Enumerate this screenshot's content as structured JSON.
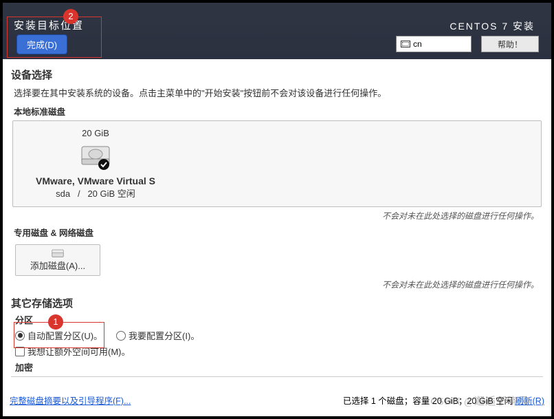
{
  "header": {
    "title": "安装目标位置",
    "done_label": "完成(D)",
    "product": "CENTOS 7 安装",
    "lang": "cn",
    "help_label": "帮助！"
  },
  "annotations": {
    "badge1": "1",
    "badge2": "2"
  },
  "device_select": {
    "title": "设备选择",
    "subtitle": "选择要在其中安装系统的设备。点击主菜单中的\"开始安装\"按钮前不会对该设备进行任何操作。",
    "local_title": "本地标准磁盘",
    "disk": {
      "size": "20 GiB",
      "name": "VMware, VMware Virtual S",
      "dev": "sda",
      "sep": "/",
      "free": "20 GiB 空闲"
    },
    "note": "不会对未在此处选择的磁盘进行任何操作。",
    "special_title": "专用磁盘 & 网络磁盘",
    "add_disk_label": "添加磁盘(A)..."
  },
  "storage_opts": {
    "title": "其它存储选项",
    "partition_label": "分区",
    "auto_label": "自动配置分区(U)。",
    "manual_label": "我要配置分区(I)。",
    "extra_space_label": "我想让额外空间可用(M)。",
    "encrypt_label": "加密"
  },
  "footer": {
    "link": "完整磁盘摘要以及引导程序(F)...",
    "status_prefix": "已选择 1 个磁盘；容量 20 GiB；20 GiB 空闲 ",
    "refresh": "刷新(R)"
  },
  "watermark": "CSDN @邂逅于晓风"
}
